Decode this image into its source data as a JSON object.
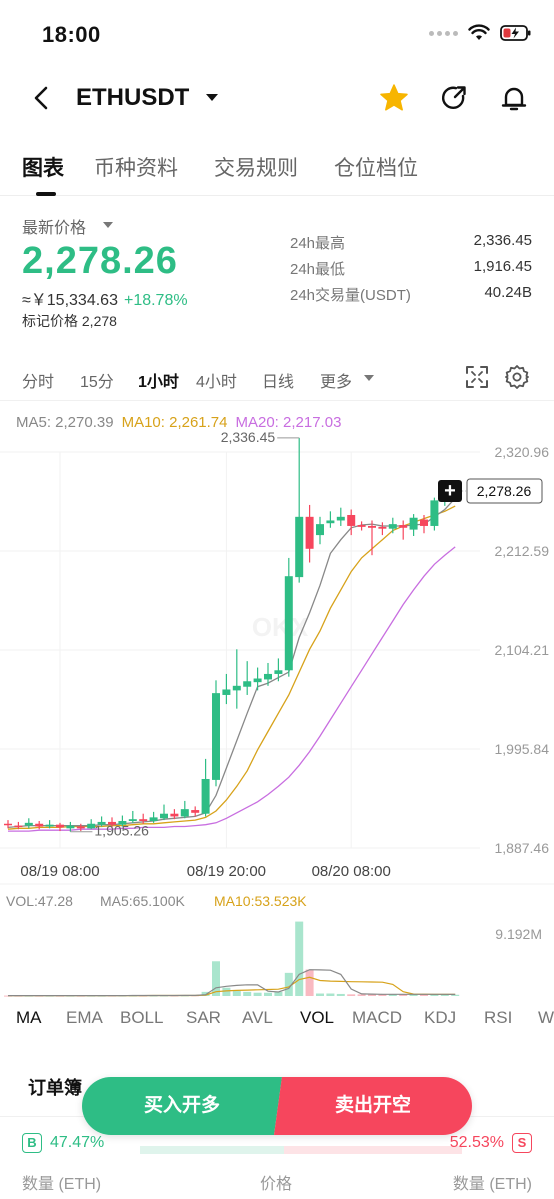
{
  "status_bar": {
    "time": "18:00"
  },
  "header": {
    "pair": "ETHUSDT"
  },
  "tabs": [
    {
      "label": "图表"
    },
    {
      "label": "币种资料"
    },
    {
      "label": "交易规则"
    },
    {
      "label": "仓位档位"
    }
  ],
  "price_panel": {
    "latest_label": "最新价格",
    "price": "2,278.26",
    "cny": "≈￥15,334.63",
    "change": "+18.78%",
    "mark_price": "标记价格 2,278",
    "stats": [
      {
        "label": "24h最高",
        "value": "2,336.45"
      },
      {
        "label": "24h最低",
        "value": "1,916.45"
      },
      {
        "label": "24h交易量(USDT)",
        "value": "40.24B"
      }
    ]
  },
  "intervals": [
    {
      "label": "分时"
    },
    {
      "label": "15分"
    },
    {
      "label": "1小时"
    },
    {
      "label": "4小时"
    },
    {
      "label": "日线"
    },
    {
      "label": "更多"
    }
  ],
  "ma_legend": {
    "ma5": "MA5: 2,270.39",
    "ma10": "MA10: 2,261.74",
    "ma20": "MA20: 2,217.03"
  },
  "colors": {
    "up": "#2ebd85",
    "down": "#f6465d",
    "ma5": "#888888",
    "ma10": "#d7a21a",
    "ma20": "#c86ee0"
  },
  "chart_data": {
    "type": "candlestick",
    "y_ticks": [
      "2,320.96",
      "2,212.59",
      "2,104.21",
      "1,995.84",
      "1,887.46"
    ],
    "x_ticks": [
      "08/19 08:00",
      "08/19 20:00",
      "08/20 08:00"
    ],
    "ylim": [
      1887.46,
      2320.96
    ],
    "high_label": "2,336.45",
    "low_label": "1,905.26",
    "last_price": "2,278.26",
    "candles": [
      {
        "o": 1914,
        "c": 1913,
        "h": 1918,
        "l": 1909
      },
      {
        "o": 1912,
        "c": 1911,
        "h": 1916,
        "l": 1908
      },
      {
        "o": 1912,
        "c": 1915,
        "h": 1920,
        "l": 1909
      },
      {
        "o": 1914,
        "c": 1911,
        "h": 1917,
        "l": 1908
      },
      {
        "o": 1911,
        "c": 1913,
        "h": 1918,
        "l": 1909
      },
      {
        "o": 1913,
        "c": 1910,
        "h": 1915,
        "l": 1906
      },
      {
        "o": 1909,
        "c": 1912,
        "h": 1916,
        "l": 1905.26
      },
      {
        "o": 1911,
        "c": 1909,
        "h": 1914,
        "l": 1906
      },
      {
        "o": 1909,
        "c": 1914,
        "h": 1919,
        "l": 1908
      },
      {
        "o": 1913,
        "c": 1916,
        "h": 1922,
        "l": 1911
      },
      {
        "o": 1916,
        "c": 1913,
        "h": 1921,
        "l": 1910
      },
      {
        "o": 1913,
        "c": 1917,
        "h": 1923,
        "l": 1911
      },
      {
        "o": 1917,
        "c": 1919,
        "h": 1928,
        "l": 1915
      },
      {
        "o": 1919,
        "c": 1917,
        "h": 1925,
        "l": 1914
      },
      {
        "o": 1917,
        "c": 1921,
        "h": 1927,
        "l": 1915
      },
      {
        "o": 1920,
        "c": 1925,
        "h": 1935,
        "l": 1918
      },
      {
        "o": 1925,
        "c": 1922,
        "h": 1930,
        "l": 1919
      },
      {
        "o": 1922,
        "c": 1930,
        "h": 1939,
        "l": 1920
      },
      {
        "o": 1929,
        "c": 1926,
        "h": 1933,
        "l": 1922
      },
      {
        "o": 1925,
        "c": 1963,
        "h": 1985,
        "l": 1922
      },
      {
        "o": 1962,
        "c": 2057,
        "h": 2071,
        "l": 1955
      },
      {
        "o": 2055,
        "c": 2061,
        "h": 2078,
        "l": 2045
      },
      {
        "o": 2060,
        "c": 2065,
        "h": 2105,
        "l": 2040
      },
      {
        "o": 2064,
        "c": 2070,
        "h": 2092,
        "l": 2055
      },
      {
        "o": 2069,
        "c": 2073,
        "h": 2085,
        "l": 2060
      },
      {
        "o": 2072,
        "c": 2078,
        "h": 2090,
        "l": 2065
      },
      {
        "o": 2078,
        "c": 2082,
        "h": 2095,
        "l": 2070
      },
      {
        "o": 2082,
        "c": 2185,
        "h": 2205,
        "l": 2075
      },
      {
        "o": 2184,
        "c": 2250,
        "h": 2336.45,
        "l": 2178
      },
      {
        "o": 2250,
        "c": 2215,
        "h": 2263,
        "l": 2200
      },
      {
        "o": 2230,
        "c": 2242,
        "h": 2250,
        "l": 2220
      },
      {
        "o": 2243,
        "c": 2246,
        "h": 2256,
        "l": 2238
      },
      {
        "o": 2246,
        "c": 2250,
        "h": 2260,
        "l": 2240
      },
      {
        "o": 2252,
        "c": 2240,
        "h": 2258,
        "l": 2230
      },
      {
        "o": 2241,
        "c": 2239,
        "h": 2245,
        "l": 2235
      },
      {
        "o": 2240,
        "c": 2238,
        "h": 2246,
        "l": 2208
      },
      {
        "o": 2239,
        "c": 2237,
        "h": 2244,
        "l": 2230
      },
      {
        "o": 2237,
        "c": 2242,
        "h": 2249,
        "l": 2232
      },
      {
        "o": 2241,
        "c": 2238,
        "h": 2246,
        "l": 2225
      },
      {
        "o": 2236,
        "c": 2249,
        "h": 2253,
        "l": 2229
      },
      {
        "o": 2247,
        "c": 2240,
        "h": 2252,
        "l": 2232
      },
      {
        "o": 2240,
        "c": 2268,
        "h": 2271,
        "l": 2235
      },
      {
        "o": 2267,
        "c": 2275,
        "h": 2290,
        "l": 2262
      },
      {
        "o": 2276,
        "c": 2278,
        "h": 2285,
        "l": 2270
      }
    ],
    "ma5": [
      1910,
      1911,
      1912,
      1912,
      1912,
      1912,
      1912,
      1912,
      1912,
      1913,
      1913,
      1914,
      1915,
      1916,
      1917,
      1919,
      1920,
      1921,
      1922,
      1926,
      1945,
      1975,
      2005,
      2035,
      2064,
      2068,
      2074,
      2080,
      2118,
      2145,
      2175,
      2210,
      2225,
      2238,
      2241,
      2242,
      2240,
      2240,
      2240,
      2241,
      2242,
      2250,
      2258,
      2270.39
    ],
    "ma10": [
      1908,
      1909,
      1909,
      1910,
      1910,
      1910,
      1911,
      1911,
      1911,
      1911,
      1912,
      1912,
      1913,
      1914,
      1914,
      1915,
      1916,
      1917,
      1918,
      1921,
      1928,
      1940,
      1955,
      1972,
      1995,
      2015,
      2035,
      2055,
      2080,
      2105,
      2125,
      2150,
      2170,
      2190,
      2205,
      2215,
      2225,
      2235,
      2240,
      2244,
      2248,
      2252,
      2256,
      2261.74
    ],
    "ma20": [
      1906,
      1906,
      1906,
      1907,
      1907,
      1907,
      1907,
      1908,
      1908,
      1908,
      1908,
      1909,
      1909,
      1910,
      1910,
      1910,
      1911,
      1911,
      1912,
      1913,
      1915,
      1920,
      1926,
      1932,
      1938,
      1946,
      1955,
      1965,
      1978,
      1993,
      2010,
      2028,
      2046,
      2064,
      2082,
      2100,
      2118,
      2136,
      2154,
      2170,
      2185,
      2198,
      2208,
      2217.03
    ],
    "volume": {
      "legend": {
        "vol": "VOL:47.28",
        "ma5": "MA5:65.100K",
        "ma10": "MA10:53.523K"
      },
      "y_tick": "9.192M",
      "ymax": 9.192
    },
    "volumes": [
      0.05,
      0.05,
      0.05,
      0.05,
      0.05,
      0.05,
      0.05,
      0.05,
      0.05,
      0.05,
      0.06,
      0.06,
      0.06,
      0.06,
      0.06,
      0.07,
      0.07,
      0.08,
      0.09,
      0.5,
      4.2,
      1.0,
      0.6,
      0.5,
      0.4,
      0.4,
      0.5,
      2.8,
      9.0,
      3.2,
      0.3,
      0.3,
      0.25,
      0.2,
      0.2,
      0.2,
      0.2,
      0.2,
      0.2,
      0.2,
      0.2,
      0.2,
      0.2,
      0.15
    ]
  },
  "sub_tabs": [
    {
      "label": "MA"
    },
    {
      "label": "EMA"
    },
    {
      "label": "BOLL"
    },
    {
      "label": "SAR"
    },
    {
      "label": "AVL"
    },
    {
      "label": "VOL"
    },
    {
      "label": "MACD"
    },
    {
      "label": "KDJ"
    },
    {
      "label": "RSI"
    },
    {
      "label": "W"
    }
  ],
  "order_book": {
    "title": "订单簿",
    "buy_badge": "B",
    "buy_pct": "47.47%",
    "sell_badge": "S",
    "sell_pct": "52.53%",
    "col_qty_left": "数量 (ETH)",
    "col_price": "价格",
    "col_qty_right": "数量 (ETH)"
  },
  "actions": {
    "buy": "买入开多",
    "sell": "卖出开空"
  }
}
